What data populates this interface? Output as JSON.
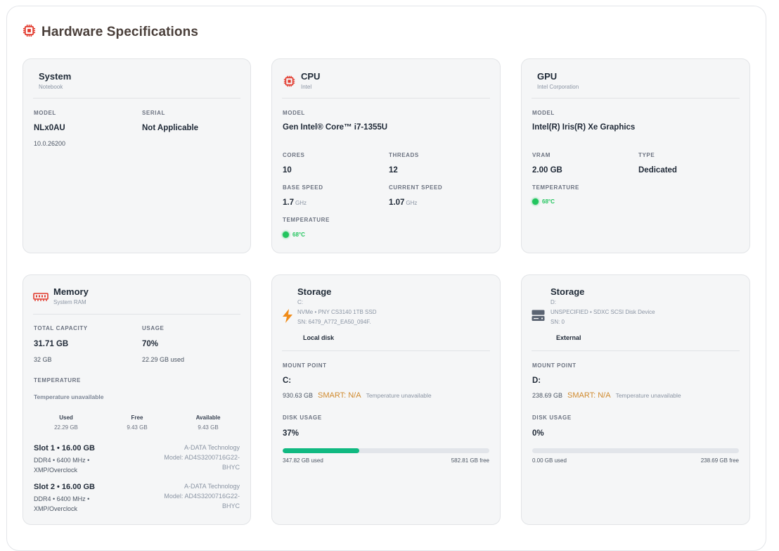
{
  "header": {
    "title": "Hardware Specifications",
    "icon": "chip-icon"
  },
  "system": {
    "title": "System",
    "subtitle": "Notebook",
    "model_label": "MODEL",
    "model": "NLx0AU",
    "version": "10.0.26200",
    "serial_label": "SERIAL",
    "serial": "Not Applicable"
  },
  "cpu": {
    "title": "CPU",
    "subtitle": "Intel",
    "model_label": "MODEL",
    "model": "Gen Intel® Core™ i7-1355U",
    "cores_label": "CORES",
    "cores": "10",
    "threads_label": "THREADS",
    "threads": "12",
    "base_label": "BASE SPEED",
    "base": "1.7",
    "base_unit": "GHz",
    "current_label": "CURRENT SPEED",
    "current": "1.07",
    "current_unit": "GHz",
    "temp_label": "TEMPERATURE",
    "temp": "68°C"
  },
  "gpu": {
    "title": "GPU",
    "subtitle": "Intel Corporation",
    "model_label": "MODEL",
    "model": "Intel(R) Iris(R) Xe Graphics",
    "vram_label": "VRAM",
    "vram": "2.00 GB",
    "type_label": "TYPE",
    "type": "Dedicated",
    "temp_label": "TEMPERATURE",
    "temp": "68°C"
  },
  "memory": {
    "title": "Memory",
    "subtitle": "System RAM",
    "capacity_label": "TOTAL CAPACITY",
    "capacity": "31.71 GB",
    "capacity_sub": "32 GB",
    "usage_label": "USAGE",
    "usage": "70%",
    "usage_sub": "22.29 GB used",
    "temp_label": "TEMPERATURE",
    "temp_text": "Temperature unavailable",
    "stats": [
      {
        "label": "Used",
        "value": "22.29 GB"
      },
      {
        "label": "Free",
        "value": "9.43 GB"
      },
      {
        "label": "Available",
        "value": "9.43 GB"
      }
    ],
    "slots": [
      {
        "title": "Slot 1 • 16.00 GB",
        "spec1": "DDR4 • 6400 MHz •",
        "spec2": "XMP/Overclock",
        "vendor": "A-DATA Technology",
        "model1": "Model: AD4S3200716G22-",
        "model2": "BHYC"
      },
      {
        "title": "Slot 2 • 16.00 GB",
        "spec1": "DDR4 • 6400 MHz •",
        "spec2": "XMP/Overclock",
        "vendor": "A-DATA Technology",
        "model1": "Model: AD4S3200716G22-",
        "model2": "BHYC"
      }
    ]
  },
  "storage1": {
    "title": "Storage",
    "drive": "C:",
    "line1": "NVMe • PNY CS3140 1TB SSD",
    "line2": "SN: 6479_A772_EA50_094F.",
    "kind": "Local disk",
    "mount_label": "MOUNT POINT",
    "mount": "C:",
    "size": "930.63 GB",
    "smart": "SMART: N/A",
    "temp_text": "Temperature unavailable",
    "usage_label": "DISK USAGE",
    "usage": "37%",
    "usage_fraction": 0.37,
    "used": "347.82 GB used",
    "free": "582.81 GB free"
  },
  "storage2": {
    "title": "Storage",
    "drive": "D:",
    "line1": "UNSPECIFIED • SDXC SCSI Disk Device",
    "line2": "SN: 0",
    "kind": "External",
    "mount_label": "MOUNT POINT",
    "mount": "D:",
    "size": "238.69 GB",
    "smart": "SMART: N/A",
    "temp_text": "Temperature unavailable",
    "usage_label": "DISK USAGE",
    "usage": "0%",
    "usage_fraction": 0.0,
    "used": "0.00 GB used",
    "free": "238.69 GB free"
  },
  "colors": {
    "accent_red": "#e23b2e",
    "bolt_orange": "#f08c1a",
    "progress_green": "#10b981",
    "temp_green": "#22c55e"
  }
}
